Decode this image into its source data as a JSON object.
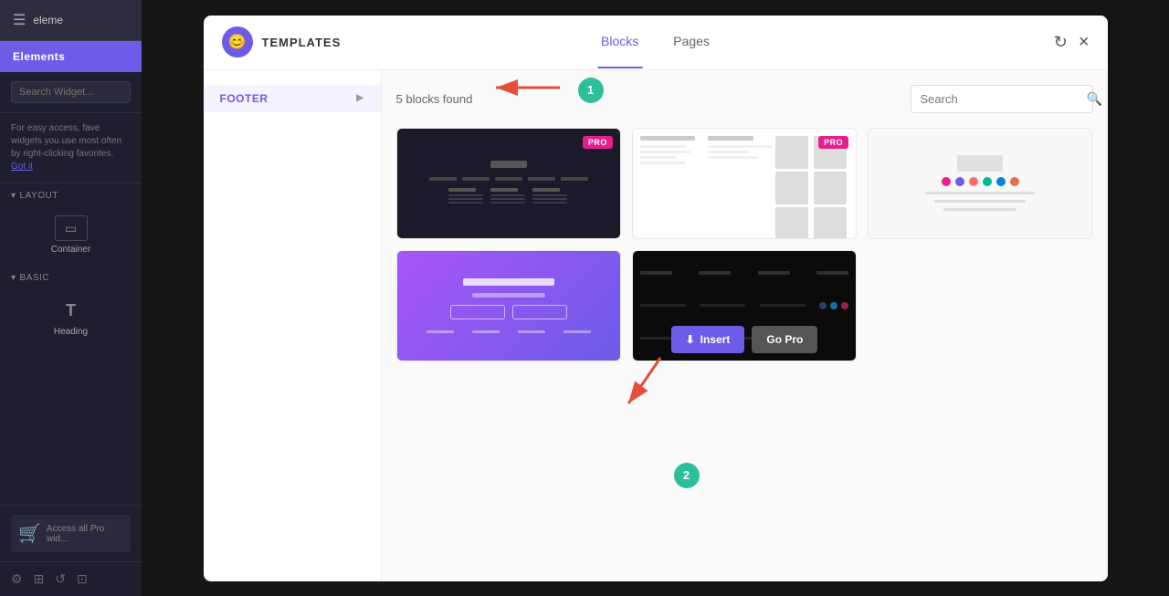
{
  "sidebar": {
    "app_name": "eleme",
    "tab": "Elements",
    "search_placeholder": "Search Widget...",
    "tip_text": "For easy access, fave widgets you use most often by right-clicking favorites.",
    "got_it_label": "Got it",
    "sections": [
      {
        "name": "Layout",
        "items": [
          {
            "label": "Container",
            "icon": "□"
          }
        ]
      },
      {
        "name": "Basic",
        "items": [
          {
            "label": "Heading",
            "icon": "T"
          }
        ]
      }
    ],
    "pro_text": "Access all Pro wid..."
  },
  "modal": {
    "logo_icon": "😊",
    "title": "TEMPLATES",
    "tabs": [
      {
        "label": "Blocks",
        "active": true
      },
      {
        "label": "Pages",
        "active": false
      }
    ],
    "refresh_icon": "↻",
    "close_icon": "×",
    "sidebar": {
      "category": "FOOTER",
      "arrow": "▶"
    },
    "content": {
      "blocks_found": "5 blocks found",
      "search_placeholder": "Search",
      "templates": [
        {
          "id": 1,
          "type": "dark-cols",
          "pro": true,
          "has_overlay": false
        },
        {
          "id": 2,
          "type": "white-team",
          "pro": true,
          "has_overlay": false
        },
        {
          "id": 3,
          "type": "light-social",
          "pro": false,
          "has_overlay": false
        },
        {
          "id": 4,
          "type": "purple-app",
          "pro": false,
          "has_overlay": false
        },
        {
          "id": 5,
          "type": "dark-strip",
          "pro": false,
          "has_overlay": true
        }
      ],
      "insert_label": "Insert",
      "pro_label": "Go Pro"
    }
  },
  "annotations": [
    {
      "number": "1",
      "label": "Category dropdown arrow"
    },
    {
      "number": "2",
      "label": "Insert button"
    }
  ],
  "colors": {
    "primary": "#6c5ce7",
    "pro_badge": "#e91e8c",
    "annotation": "#2dbf9a",
    "arrow": "#e74c3c"
  }
}
